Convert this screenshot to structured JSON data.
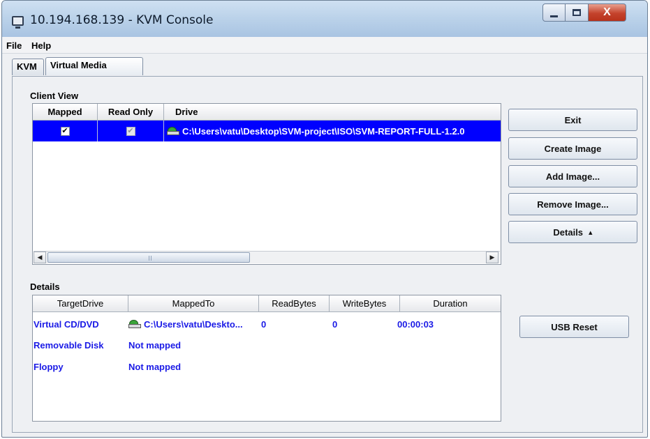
{
  "window": {
    "title": "10.194.168.139 - KVM Console",
    "close_glyph": "X"
  },
  "menu": [
    {
      "label": "File"
    },
    {
      "label": "Help"
    }
  ],
  "tabs": [
    {
      "label": "KVM",
      "active": false
    },
    {
      "label": "Virtual Media",
      "active": true
    }
  ],
  "client_view": {
    "label": "Client View",
    "columns": [
      "Mapped",
      "Read Only",
      "Drive"
    ],
    "rows": [
      {
        "mapped": true,
        "read_only": true,
        "read_only_enabled": false,
        "drive_icon": "cd-drive-icon",
        "drive": "C:\\Users\\vatu\\Desktop\\SVM-project\\ISO\\SVM-REPORT-FULL-1.2.0",
        "selected": true
      }
    ]
  },
  "buttons": {
    "exit": "Exit",
    "create_image": "Create Image",
    "add_image": "Add Image...",
    "remove_image": "Remove Image...",
    "details": "Details",
    "details_glyph": "▴",
    "usb_reset": "USB Reset"
  },
  "details": {
    "label": "Details",
    "columns": [
      "TargetDrive",
      "MappedTo",
      "ReadBytes",
      "WriteBytes",
      "Duration"
    ],
    "rows": [
      {
        "target": "Virtual CD/DVD",
        "icon": "cd-drive-icon",
        "mapped_to": "C:\\Users\\vatu\\Deskto...",
        "read_bytes": "0",
        "write_bytes": "0",
        "duration": "00:00:03"
      },
      {
        "target": "Removable Disk",
        "mapped_to": "Not mapped",
        "read_bytes": "",
        "write_bytes": "",
        "duration": ""
      },
      {
        "target": "Floppy",
        "mapped_to": "Not mapped",
        "read_bytes": "",
        "write_bytes": "",
        "duration": ""
      }
    ]
  },
  "colors": {
    "selection": "#0000ff",
    "details_text": "#1a1ae6"
  }
}
